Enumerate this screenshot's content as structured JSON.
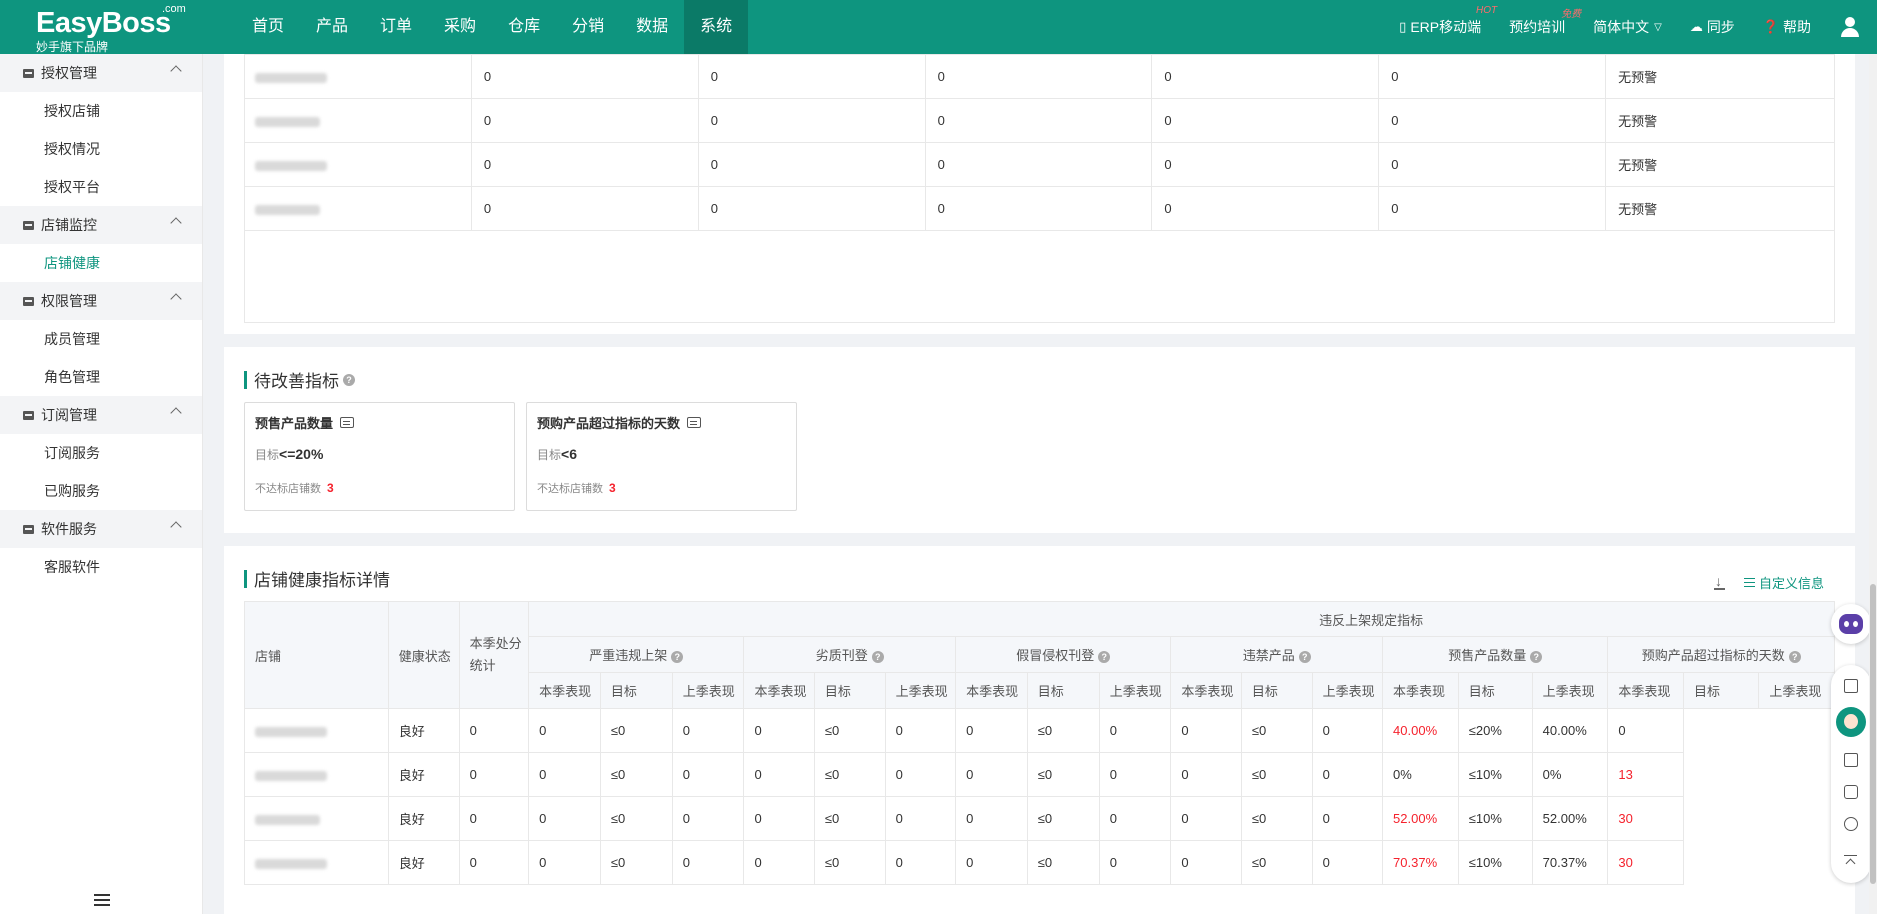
{
  "brand": {
    "name": "EasyBoss",
    "dotcom": ".com",
    "tagline": "妙手旗下品牌"
  },
  "nav": [
    "首页",
    "产品",
    "订单",
    "采购",
    "仓库",
    "分销",
    "数据",
    "系统"
  ],
  "nav_active_index": 7,
  "header_right": {
    "erp_mobile": "ERP移动端",
    "erp_badge": "HOT",
    "training": "预约培训",
    "training_badge": "免费",
    "language": "简体中文",
    "sync": "同步",
    "help": "帮助"
  },
  "sidebar": {
    "groups": [
      {
        "title": "授权管理",
        "icon": "store-icon",
        "items": [
          "授权店铺",
          "授权情况",
          "授权平台"
        ]
      },
      {
        "title": "店铺监控",
        "icon": "monitor-user-icon",
        "items": [
          "店铺健康"
        ]
      },
      {
        "title": "权限管理",
        "icon": "user-key-icon",
        "items": [
          "成员管理",
          "角色管理"
        ]
      },
      {
        "title": "订阅管理",
        "icon": "subscription-icon",
        "items": [
          "订阅服务",
          "已购服务"
        ]
      },
      {
        "title": "软件服务",
        "icon": "service-icon",
        "items": [
          "客服软件"
        ]
      }
    ],
    "active_item": "店铺健康"
  },
  "top_table": {
    "rows": [
      [
        "0",
        "0",
        "0",
        "0",
        "0",
        "无预警"
      ],
      [
        "0",
        "0",
        "0",
        "0",
        "0",
        "无预警"
      ],
      [
        "0",
        "0",
        "0",
        "0",
        "0",
        "无预警"
      ],
      [
        "0",
        "0",
        "0",
        "0",
        "0",
        "无预警"
      ]
    ]
  },
  "improve": {
    "title": "待改善指标",
    "cards": [
      {
        "title": "预售产品数量",
        "target_label": "目标",
        "target": "<=20%",
        "miss_label": "不达标店铺数",
        "miss_count": "3"
      },
      {
        "title": "预购产品超过指标的天数",
        "target_label": "目标",
        "target": "<6",
        "miss_label": "不达标店铺数",
        "miss_count": "3"
      }
    ]
  },
  "detail": {
    "title": "店铺健康指标详情",
    "custom_label": "自定义信息",
    "col_store": "店铺",
    "col_health": "健康状态",
    "col_penalty": "本季处分统计",
    "group_header": "违反上架规定指标",
    "metrics": [
      "严重违规上架",
      "劣质刊登",
      "假冒侵权刊登",
      "违禁产品",
      "预售产品数量",
      "预购产品超过指标的天数"
    ],
    "subcols": [
      "本季表现",
      "目标",
      "上季表现"
    ],
    "rows": [
      {
        "health": "良好",
        "penalty": "0",
        "cells": [
          "0",
          "≤0",
          "0",
          "0",
          "≤0",
          "0",
          "0",
          "≤0",
          "0",
          "0",
          "≤0",
          "0",
          "40.00%",
          "≤20%",
          "40.00%",
          "0"
        ],
        "red": [
          12
        ]
      },
      {
        "health": "良好",
        "penalty": "0",
        "cells": [
          "0",
          "≤0",
          "0",
          "0",
          "≤0",
          "0",
          "0",
          "≤0",
          "0",
          "0",
          "≤0",
          "0",
          "0%",
          "≤10%",
          "0%",
          "13"
        ],
        "red": [
          15
        ]
      },
      {
        "health": "良好",
        "penalty": "0",
        "cells": [
          "0",
          "≤0",
          "0",
          "0",
          "≤0",
          "0",
          "0",
          "≤0",
          "0",
          "0",
          "≤0",
          "0",
          "52.00%",
          "≤10%",
          "52.00%",
          "30"
        ],
        "red": [
          12,
          15
        ]
      },
      {
        "health": "良好",
        "penalty": "0",
        "cells": [
          "0",
          "≤0",
          "0",
          "0",
          "≤0",
          "0",
          "0",
          "≤0",
          "0",
          "0",
          "≤0",
          "0",
          "70.37%",
          "≤10%",
          "70.37%",
          "30"
        ],
        "red": [
          12,
          15
        ]
      }
    ]
  },
  "colors": {
    "brand": "#0e957f",
    "alert": "#f5222d"
  }
}
